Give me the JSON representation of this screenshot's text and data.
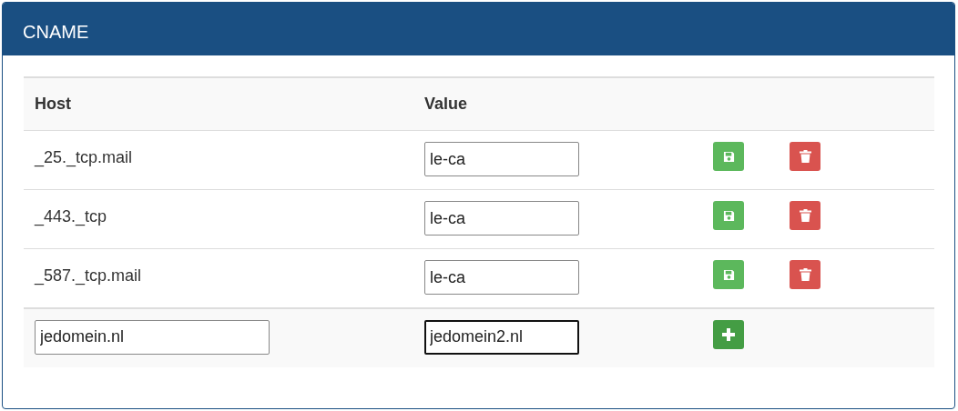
{
  "panel": {
    "title": "CNAME"
  },
  "table": {
    "columns": [
      "Host",
      "Value"
    ],
    "rows": [
      {
        "host": "_25._tcp.mail",
        "value": "le-ca"
      },
      {
        "host": "_443._tcp",
        "value": "le-ca"
      },
      {
        "host": "_587._tcp.mail",
        "value": "le-ca"
      }
    ],
    "new_row": {
      "host": {
        "value": "jedomein.nl",
        "focused": false
      },
      "value": {
        "value": "jedomein2.nl",
        "focused": true
      }
    }
  }
}
